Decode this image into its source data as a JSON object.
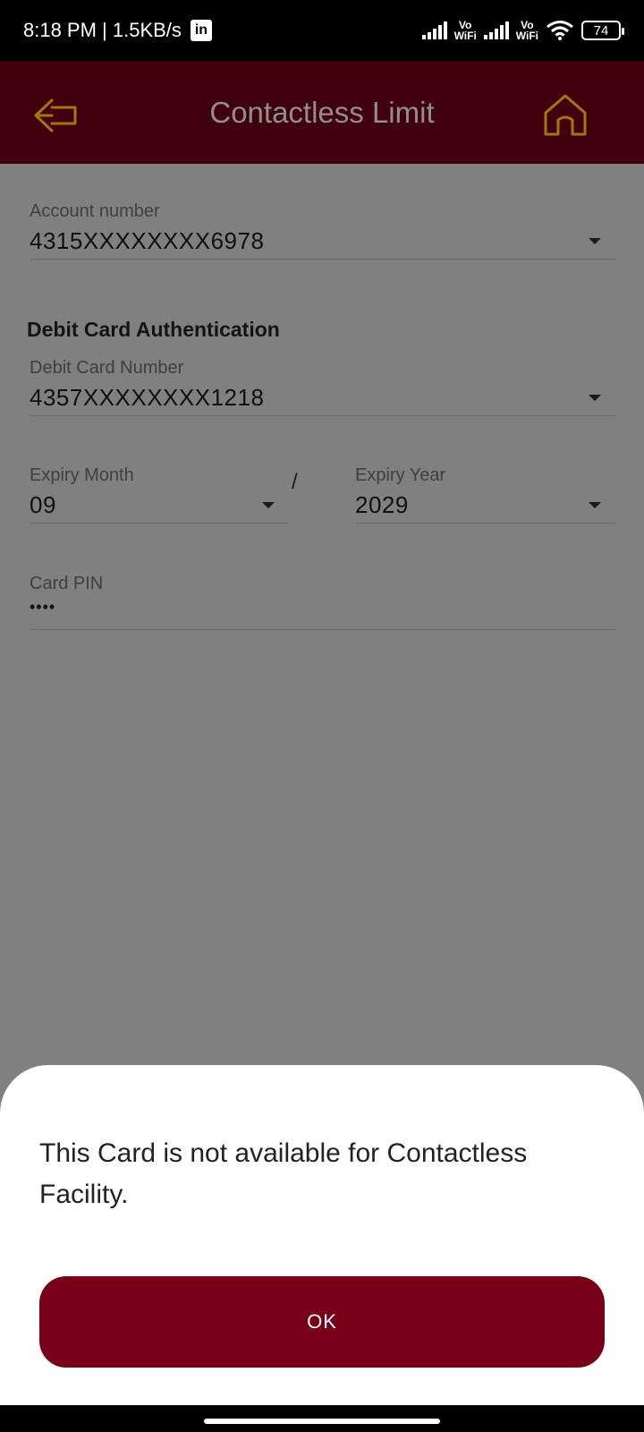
{
  "status_bar": {
    "time_speed": "8:18 PM | 1.5KB/s",
    "linkedin_badge": "in",
    "vowifi_1": "Vo\nWiFi",
    "vowifi_2": "Vo\nWiFi",
    "battery": "74"
  },
  "header": {
    "title": "Contactless Limit",
    "back_icon": "back-arrow-icon",
    "home_icon": "home-icon",
    "icon_color": "#b8860b",
    "background": "#41000d"
  },
  "form": {
    "account_number": {
      "label": "Account number",
      "value": "4315XXXXXXXX6978"
    },
    "section_title": "Debit Card Authentication",
    "debit_card_number": {
      "label": "Debit Card Number",
      "value": "4357XXXXXXXX1218"
    },
    "expiry_month": {
      "label": "Expiry Month",
      "value": "09"
    },
    "expiry_separator": "/",
    "expiry_year": {
      "label": "Expiry Year",
      "value": "2029"
    },
    "card_pin": {
      "label": "Card PIN",
      "value": "••••"
    }
  },
  "dialog": {
    "message": "This Card is not available for Contactless Facility.",
    "ok_label": "OK",
    "button_color": "#790019"
  }
}
